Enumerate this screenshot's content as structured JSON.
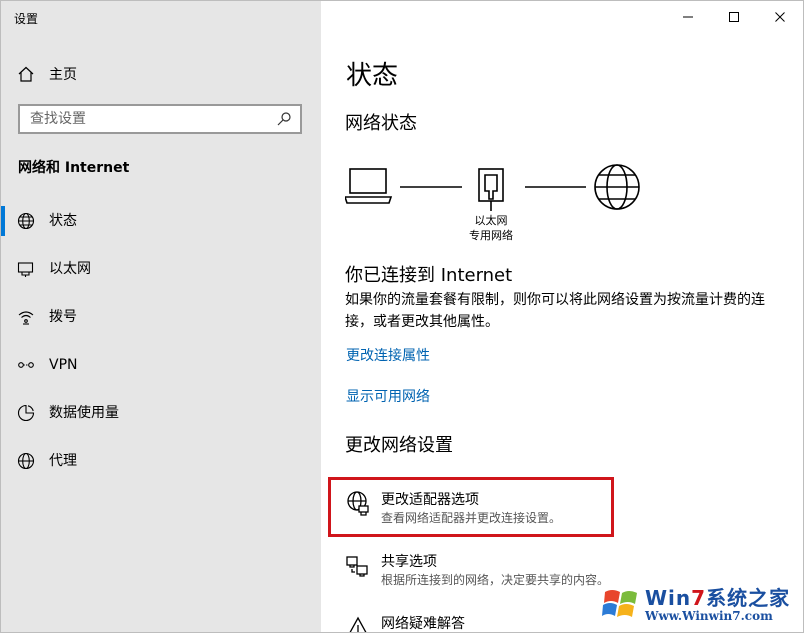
{
  "window": {
    "title": "设置",
    "controls": {
      "minimize": "minimize",
      "maximize": "maximize",
      "close": "close"
    }
  },
  "sidebar": {
    "home_label": "主页",
    "search": {
      "placeholder": "查找设置",
      "value": ""
    },
    "section_title": "网络和 Internet",
    "items": [
      {
        "label": "状态",
        "icon": "globe-icon",
        "selected": true
      },
      {
        "label": "以太网",
        "icon": "ethernet-icon",
        "selected": false
      },
      {
        "label": "拨号",
        "icon": "dialup-icon",
        "selected": false
      },
      {
        "label": "VPN",
        "icon": "vpn-icon",
        "selected": false
      },
      {
        "label": "数据使用量",
        "icon": "data-usage-icon",
        "selected": false
      },
      {
        "label": "代理",
        "icon": "proxy-globe-icon",
        "selected": false
      }
    ],
    "accent_color": "#0078d7"
  },
  "main": {
    "title": "状态",
    "network_status_heading": "网络状态",
    "diagram": {
      "adapter_name": "以太网",
      "network_type": "专用网络"
    },
    "connected_heading": "你已连接到 Internet",
    "connected_text": "如果你的流量套餐有限制，则你可以将此网络设置为按流量计费的连接，或者更改其他属性。",
    "links": {
      "change_properties": "更改连接属性",
      "show_available": "显示可用网络"
    },
    "change_settings_heading": "更改网络设置",
    "options": [
      {
        "title": "更改适配器选项",
        "desc": "查看网络适配器并更改连接设置。",
        "icon": "adapter-icon",
        "highlighted": true
      },
      {
        "title": "共享选项",
        "desc": "根据所连接到的网络，决定要共享的内容。",
        "icon": "sharing-icon",
        "highlighted": false
      },
      {
        "title": "网络疑难解答",
        "desc": "",
        "icon": "warning-icon",
        "highlighted": false
      }
    ],
    "link_color": "#0063b1",
    "highlight_color": "#d0151b"
  },
  "watermark": {
    "brand_prefix": "Win",
    "brand_seven": "7",
    "brand_suffix": "系统之家",
    "url": "Www.Winwin7.com"
  }
}
